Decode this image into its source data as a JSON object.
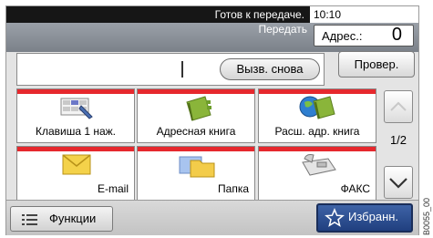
{
  "status": {
    "message": "Готов к передаче.",
    "time": "10:10"
  },
  "header": {
    "title": "Передать"
  },
  "address": {
    "label": "Адрес.:",
    "count": "0"
  },
  "buttons": {
    "check": "Провер.",
    "resend": "Вызв. снова"
  },
  "tiles": [
    {
      "label": "Клавиша 1 наж.",
      "icon": "one-touch-key-icon"
    },
    {
      "label": "Адресная книга",
      "icon": "address-book-icon"
    },
    {
      "label": "Расш. адр. книга",
      "icon": "ext-address-book-icon"
    },
    {
      "label": "E-mail",
      "icon": "email-envelope-icon"
    },
    {
      "label": "Папка",
      "icon": "folder-icon"
    },
    {
      "label": "ФАКС",
      "icon": "fax-machine-icon"
    }
  ],
  "pager": {
    "page": "1/2"
  },
  "bottom": {
    "functions": "Функции",
    "favorites": "Избранн."
  },
  "side_code": "B0055_00",
  "colors": {
    "accent_red": "#e6282d",
    "favorites_blue": "#2c4d8e",
    "status_black": "#161616"
  }
}
